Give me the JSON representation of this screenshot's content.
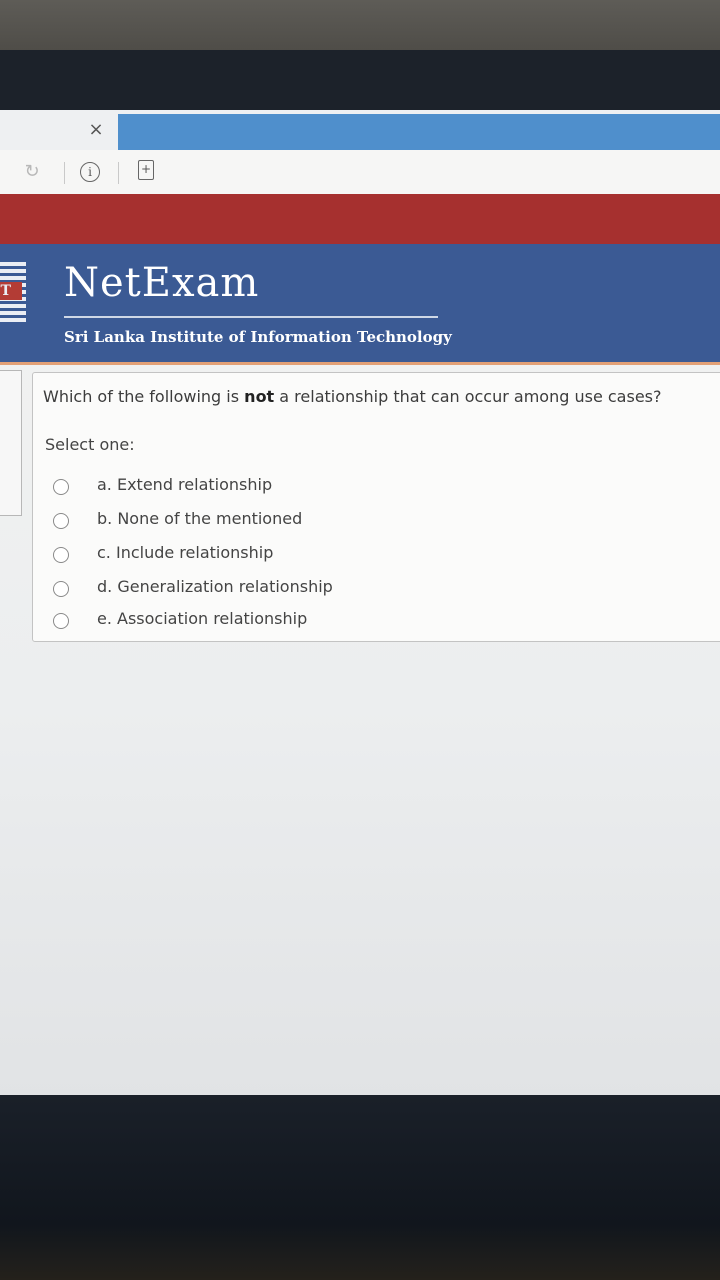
{
  "browser": {
    "tab_close_glyph": "×",
    "info_glyph": "i",
    "page_glyph": "+"
  },
  "site": {
    "title": "NetExam",
    "subtitle": "Sri Lanka Institute of Information Technology",
    "logo_text": "IT"
  },
  "question": {
    "text_before": "Which of the following is ",
    "text_emphasis": "not",
    "text_after": " a relationship that can occur among use cases?",
    "prompt": "Select one:",
    "options": [
      {
        "label": "a. Extend relationship",
        "selected": false
      },
      {
        "label": "b. None of the mentioned",
        "selected": false
      },
      {
        "label": "c. Include relationship",
        "selected": false
      },
      {
        "label": "d. Generalization relationship",
        "selected": false
      },
      {
        "label": "e. Association relationship",
        "selected": false
      }
    ]
  },
  "colors": {
    "header_red": "#a6302f",
    "header_blue": "#3b5a94",
    "tab_blue": "#4f8fcc"
  }
}
